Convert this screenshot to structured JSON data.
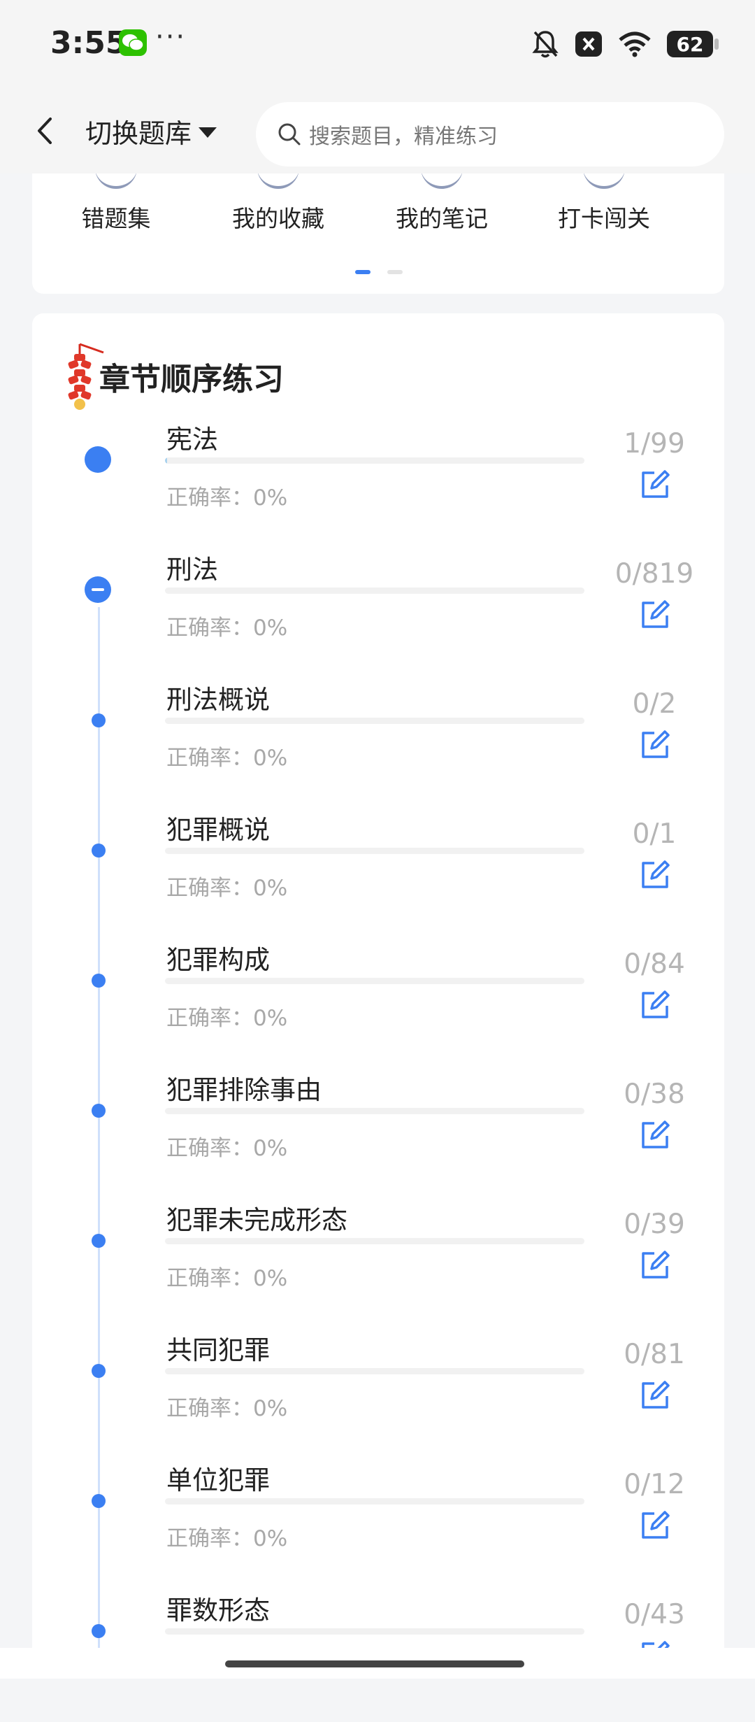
{
  "status_bar": {
    "time": "3:55",
    "dots": "···",
    "battery": "62"
  },
  "header": {
    "bank_label": "切换题库",
    "search_placeholder": "搜索题目，精准练习"
  },
  "quick_links": [
    {
      "label": "错题集"
    },
    {
      "label": "我的收藏"
    },
    {
      "label": "我的笔记"
    },
    {
      "label": "打卡闯关"
    }
  ],
  "chapter_section": {
    "title": "章节顺序练习",
    "accuracy_prefix": "正确率：",
    "items": [
      {
        "name": "宪法",
        "progress": "1/99",
        "accuracy": "0%",
        "fill": 0.005,
        "state": "big"
      },
      {
        "name": "刑法",
        "progress": "0/819",
        "accuracy": "0%",
        "fill": 0,
        "state": "expanded"
      },
      {
        "name": "刑法概说",
        "progress": "0/2",
        "accuracy": "0%",
        "fill": 0,
        "state": "child"
      },
      {
        "name": "犯罪概说",
        "progress": "0/1",
        "accuracy": "0%",
        "fill": 0,
        "state": "child"
      },
      {
        "name": "犯罪构成",
        "progress": "0/84",
        "accuracy": "0%",
        "fill": 0,
        "state": "child"
      },
      {
        "name": "犯罪排除事由",
        "progress": "0/38",
        "accuracy": "0%",
        "fill": 0,
        "state": "child"
      },
      {
        "name": "犯罪未完成形态",
        "progress": "0/39",
        "accuracy": "0%",
        "fill": 0,
        "state": "child"
      },
      {
        "name": "共同犯罪",
        "progress": "0/81",
        "accuracy": "0%",
        "fill": 0,
        "state": "child"
      },
      {
        "name": "单位犯罪",
        "progress": "0/12",
        "accuracy": "0%",
        "fill": 0,
        "state": "child"
      },
      {
        "name": "罪数形态",
        "progress": "0/43",
        "accuracy": "0%",
        "fill": 0,
        "state": "child"
      }
    ]
  },
  "colors": {
    "accent": "#3b7ff2",
    "muted_text": "#a8a8a8"
  }
}
